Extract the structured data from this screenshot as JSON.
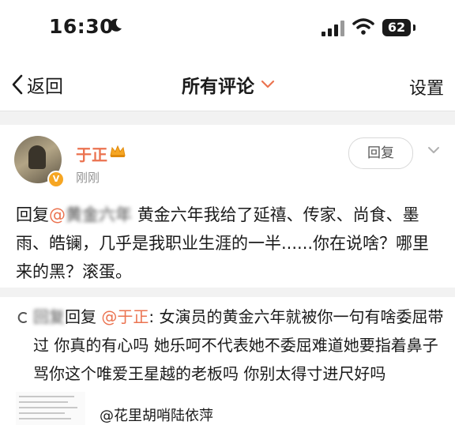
{
  "status_bar": {
    "time": "16:30",
    "battery": "62"
  },
  "nav": {
    "back_label": "返回",
    "title": "所有评论",
    "settings_label": "设置"
  },
  "comment": {
    "username": "于正",
    "timestamp": "刚刚",
    "reply_button": "回复",
    "prefix": "回复",
    "mention": "@",
    "blurred_handle": "黄金六年",
    "body": "黄金六年我给了延禧、传家、尚食、墨雨、皓镧，几乎是我职业生涯的一半......你在说啥？哪里来的黑？滚蛋。"
  },
  "quote": {
    "blurred_handle": "回复",
    "prefix": "回复",
    "mention": "@于正",
    "body": ": 女演员的黄金六年就被你一句有啥委屈带过 你真的有心吗 她乐呵不代表她不委屈难道她要指着鼻子骂你这个唯爱王星越的老板吗 你别太得寸进尺好吗"
  },
  "footer": {
    "mention": "@花里胡哨陆依萍"
  },
  "colors": {
    "accent": "#eb7350",
    "gray_text": "#939393",
    "verified": "#f6a623"
  }
}
